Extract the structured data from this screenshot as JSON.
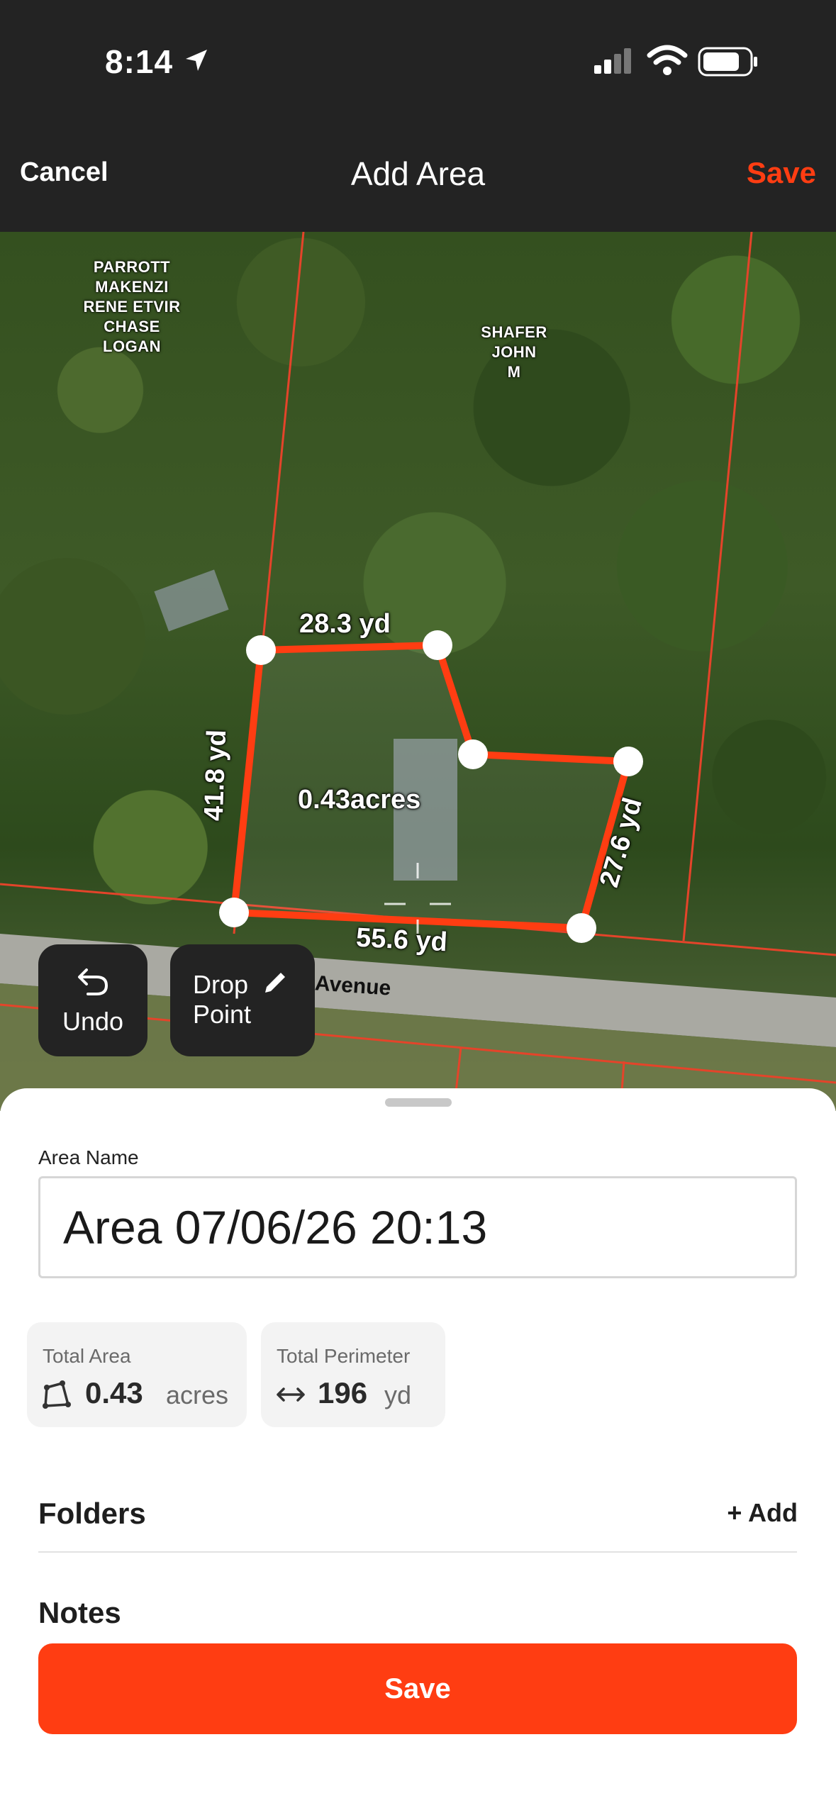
{
  "status_bar": {
    "time": "8:14"
  },
  "nav": {
    "cancel_label": "Cancel",
    "title": "Add Area",
    "save_label": "Save"
  },
  "map": {
    "owner_labels": [
      [
        "PARROTT",
        "MAKENZI",
        "RENE ETVIR",
        "CHASE",
        "LOGAN"
      ],
      [
        "SHAFER",
        "JOHN",
        "M"
      ]
    ],
    "segments": [
      "28.3 yd",
      "41.8 yd",
      "27.6 yd",
      "55.6 yd"
    ],
    "area_label": "0.43acres",
    "street_label": "Avenue",
    "undo_label": "Undo",
    "drop_point_label": [
      "Drop",
      "Point"
    ],
    "polygon_color": "#ff3d12"
  },
  "sheet": {
    "area_name_label": "Area Name",
    "area_name_value": "Area 07/06/26 20:13",
    "total_area": {
      "title": "Total Area",
      "value": "0.43",
      "unit": "acres"
    },
    "total_perimeter": {
      "title": "Total Perimeter",
      "value": "196",
      "unit": "yd"
    },
    "folders_title": "Folders",
    "add_label": "+ Add",
    "notes_title": "Notes",
    "save_label": "Save"
  },
  "colors": {
    "accent": "#ff3d12",
    "dark": "#232323"
  }
}
